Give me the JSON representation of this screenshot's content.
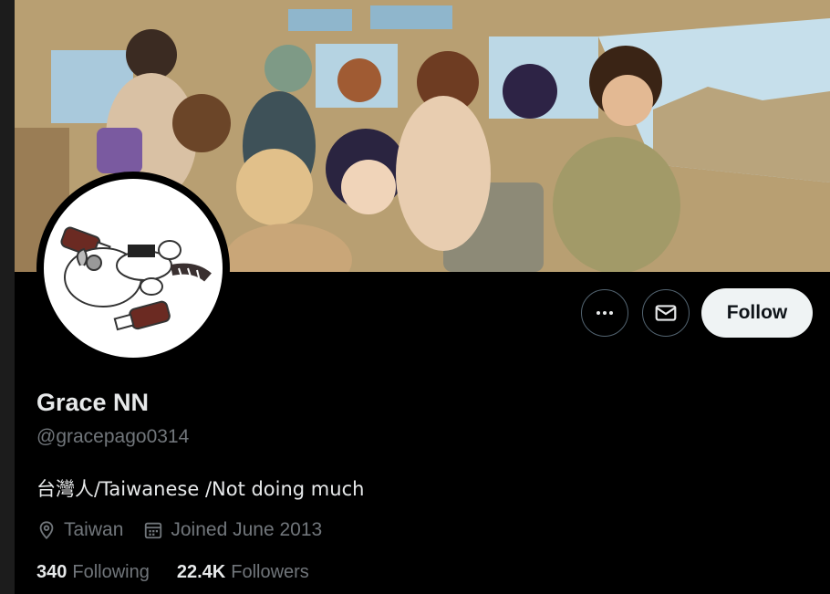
{
  "profile": {
    "display_name": "Grace NN",
    "handle": "@gracepago0314",
    "bio": "台灣人/Taiwanese /Not doing much",
    "location": "Taiwan",
    "joined": "Joined June 2013"
  },
  "actions": {
    "follow_label": "Follow",
    "more_icon": "more-icon",
    "message_icon": "envelope-icon"
  },
  "stats": {
    "following_count": "340",
    "following_label": "Following",
    "followers_count": "22.4K",
    "followers_label": "Followers"
  },
  "colors": {
    "background": "#000000",
    "text_primary": "#e7e9ea",
    "text_secondary": "#71767b",
    "follow_button_bg": "#eff3f4"
  }
}
